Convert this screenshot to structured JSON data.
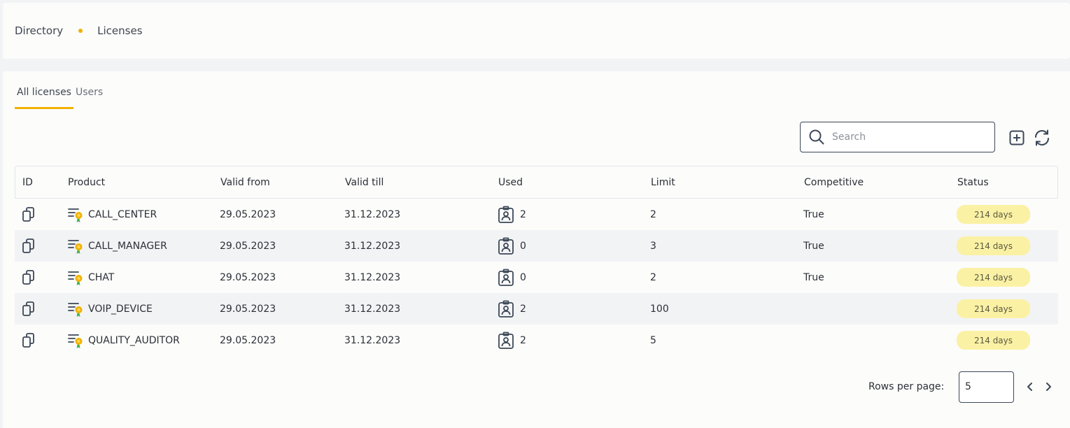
{
  "breadcrumb": {
    "items": [
      "Directory",
      "Licenses"
    ]
  },
  "tabs": [
    {
      "label": "All licenses",
      "active": true
    },
    {
      "label": "Users",
      "active": false
    }
  ],
  "search": {
    "placeholder": "Search",
    "value": ""
  },
  "table": {
    "columns": [
      "ID",
      "Product",
      "Valid from",
      "Valid till",
      "Used",
      "Limit",
      "Competitive",
      "Status"
    ],
    "rows": [
      {
        "product": "CALL_CENTER",
        "valid_from": "29.05.2023",
        "valid_till": "31.12.2023",
        "used": "2",
        "limit": "2",
        "competitive": "True",
        "status": "214 days"
      },
      {
        "product": "CALL_MANAGER",
        "valid_from": "29.05.2023",
        "valid_till": "31.12.2023",
        "used": "0",
        "limit": "3",
        "competitive": "True",
        "status": "214 days"
      },
      {
        "product": "CHAT",
        "valid_from": "29.05.2023",
        "valid_till": "31.12.2023",
        "used": "0",
        "limit": "2",
        "competitive": "True",
        "status": "214 days"
      },
      {
        "product": "VOIP_DEVICE",
        "valid_from": "29.05.2023",
        "valid_till": "31.12.2023",
        "used": "2",
        "limit": "100",
        "competitive": "",
        "status": "214 days"
      },
      {
        "product": "QUALITY_AUDITOR",
        "valid_from": "29.05.2023",
        "valid_till": "31.12.2023",
        "used": "2",
        "limit": "5",
        "competitive": "",
        "status": "214 days"
      }
    ]
  },
  "pagination": {
    "rows_label": "Rows per page:",
    "rows_value": "5"
  },
  "icons": {
    "copy": "copy-icon",
    "product": "license-list-icon",
    "used": "user-badge-icon",
    "add": "add-square-icon",
    "refresh": "refresh-icon",
    "search": "search-icon",
    "prev": "chevron-left-icon",
    "next": "chevron-right-icon"
  },
  "colors": {
    "accent": "#f2b100",
    "icon": "#3c4857",
    "badge_bg": "#fbf1a4",
    "row_alt": "#f2f3f5"
  }
}
